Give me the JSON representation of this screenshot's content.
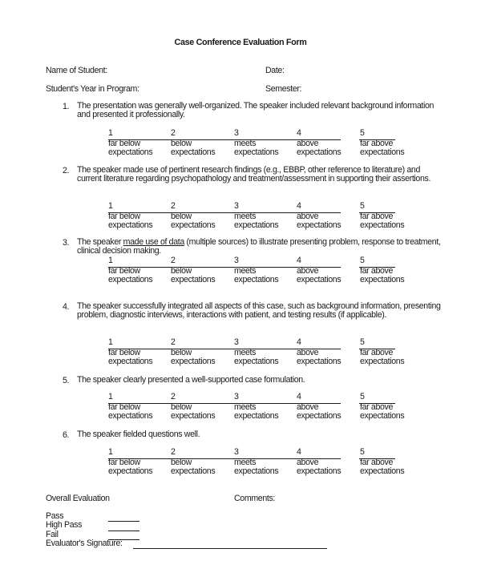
{
  "title": "Case Conference Evaluation Form",
  "header_fields": {
    "name_of_student": "Name of Student:",
    "date": "Date:",
    "year_in_program": "Student's Year in Program:",
    "semester": "Semester:"
  },
  "scale": {
    "numbers": [
      "1",
      "2",
      "3",
      "4",
      "5"
    ],
    "labels_line1": [
      "far below",
      "below",
      "meets",
      "above",
      "far above"
    ],
    "labels_line2": [
      "expectations",
      "expectations",
      "expectations",
      "expectations",
      "expectations"
    ]
  },
  "questions": [
    {
      "number": "1.",
      "text": "The presentation was generally well-organized. The speaker included relevant background information and presented it professionally."
    },
    {
      "number": "2.",
      "text": "The speaker made use of pertinent research findings (e.g., EBBP, other reference to literature) and current literature regarding psychopathology and treatment/assessment in supporting their assertions."
    },
    {
      "number": "3.",
      "text_before": "The speaker ",
      "text_underlined": "made use of data",
      "text_after": " (multiple sources) to illustrate presenting problem, response to treatment, clinical decision making."
    },
    {
      "number": "4.",
      "text": "The speaker successfully integrated all aspects of this case, such as background information, presenting problem, diagnostic interviews, interactions with patient, and testing results (if applicable)."
    },
    {
      "number": "5.",
      "text": "The speaker clearly presented a well-supported case formulation."
    },
    {
      "number": "6.",
      "text": "The speaker fielded questions well."
    }
  ],
  "overall": {
    "heading": "Overall Evaluation",
    "comments_label": "Comments:",
    "options": [
      "Pass",
      "High Pass",
      "Fail"
    ],
    "signature_label": "Evaluator's Signature:"
  }
}
